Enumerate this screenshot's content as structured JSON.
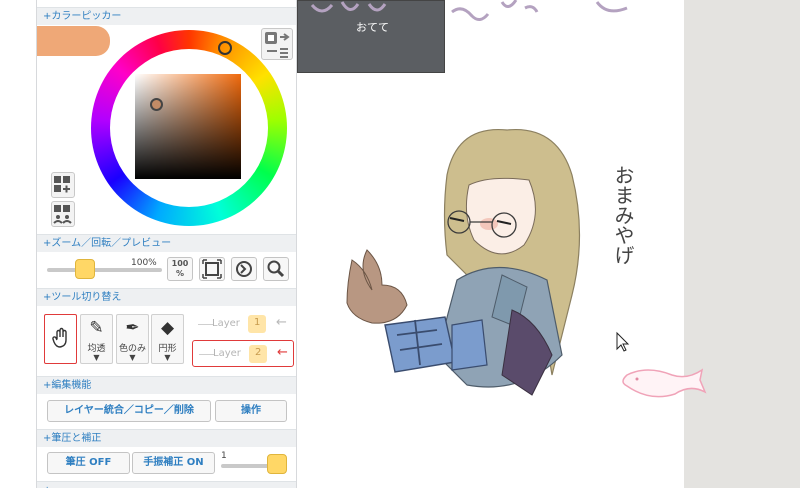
{
  "sections": {
    "color_picker": "+カラーピッカー",
    "zoom": "+ズーム／回転／プレビュー",
    "tool_switch": "+ツール切り替え",
    "edit": "+編集機能",
    "pen": "+筆圧と補正",
    "next": "+"
  },
  "zoom": {
    "percent": "100%",
    "btn_100": "100\n%"
  },
  "tools": [
    {
      "label": ""
    },
    {
      "label": "均透"
    },
    {
      "label": "色のみ"
    },
    {
      "label": "円形"
    }
  ],
  "layers": [
    {
      "label": "Layer",
      "num": "1"
    },
    {
      "label": "Layer",
      "num": "2"
    }
  ],
  "edit": {
    "merge_button": "レイヤー統合／コピー／削除",
    "operation_button": "操作"
  },
  "pen": {
    "pressure_button": "筆圧 OFF",
    "stabilizer_button": "手振補正 ON",
    "stabilizer_value": "1"
  },
  "overlay": {
    "label": "おてて"
  },
  "canvas_text": {
    "title": "おまみやげ"
  },
  "colors": {
    "accent": "#2f7fc1",
    "swatch": "#efa877",
    "thumb": "#ffd766",
    "active_red": "#e03a3a"
  },
  "chart_data": null
}
